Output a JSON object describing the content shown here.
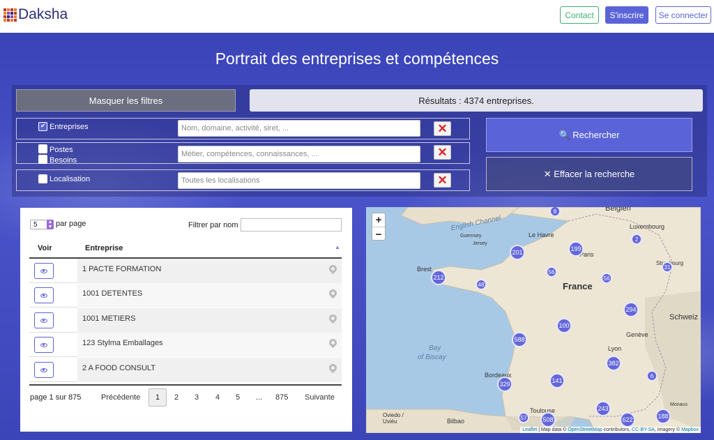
{
  "brand": {
    "name": "Daksha"
  },
  "header": {
    "contact": "Contact",
    "signup": "S'inscrire",
    "login": "Se connecter"
  },
  "hero": {
    "title": "Portrait des entreprises et compétences"
  },
  "filters": {
    "toggle_label": "Masquer les filtres",
    "results_text": "Résultats : 4374 entreprises.",
    "rows": [
      {
        "options": [
          {
            "label": "Entreprises",
            "checked": true
          }
        ],
        "placeholder": "Nom, domaine, activité, siret, ..."
      },
      {
        "options": [
          {
            "label": "Postes",
            "checked": false
          },
          {
            "label": "Besoins",
            "checked": false
          }
        ],
        "placeholder": "Métier, compétences, connaissances, ..."
      },
      {
        "options": [
          {
            "label": "Localisation",
            "checked": false
          }
        ],
        "placeholder": "Toutes les localisations"
      }
    ],
    "clear_icon": "✕",
    "search_label": "🔍 Rechercher",
    "clear_label": "✕ Effacer la recherche"
  },
  "table": {
    "page_size": "5",
    "per_page_label": "par page",
    "filter_label": "Filtrer par nom",
    "col_view": "Voir",
    "col_company": "Entreprise",
    "rows": [
      "1 PACTE FORMATION",
      "1001 DETENTES",
      "1001 METIERS",
      "123 Stylma Emballages",
      "2 A FOOD CONSULT"
    ],
    "page_info": "page 1 sur 875",
    "prev": "Précédente",
    "pages": [
      "1",
      "2",
      "3",
      "4",
      "5",
      "...",
      "875"
    ],
    "next": "Suivante"
  },
  "map": {
    "zoom_in": "+",
    "zoom_out": "−",
    "labels": [
      "Belgien",
      "Luxembourg",
      "English Channel",
      "Le Havre",
      "Guernsey",
      "Jersey",
      "Paris",
      "Brest",
      "France",
      "Strasbourg",
      "Bay",
      "of Biscay",
      "Genève",
      "Lyon",
      "Schweiz",
      "Bordeaux",
      "Toulouse",
      "Monaco",
      "Oviedo / Uviéu",
      "Bilbao"
    ],
    "clusters": [
      "8",
      "2",
      "201",
      "199",
      "31",
      "212",
      "56",
      "48",
      "56",
      "294",
      "100",
      "588",
      "382",
      "329",
      "141",
      "6",
      "57",
      "243",
      "508",
      "622",
      "188"
    ],
    "attribution": {
      "leaflet": "Leaflet",
      "text1": " | Map data © ",
      "osm": "OpenStreetMap",
      "text2": " contributors, ",
      "cc": "CC-BY-SA",
      "text3": ", Imagery © ",
      "mapbox": "Mapbox"
    }
  },
  "colors": {
    "accent": "#5b63d8",
    "contact": "#3cb371",
    "cluster": "#6366da",
    "logo": "#2b2d78"
  }
}
